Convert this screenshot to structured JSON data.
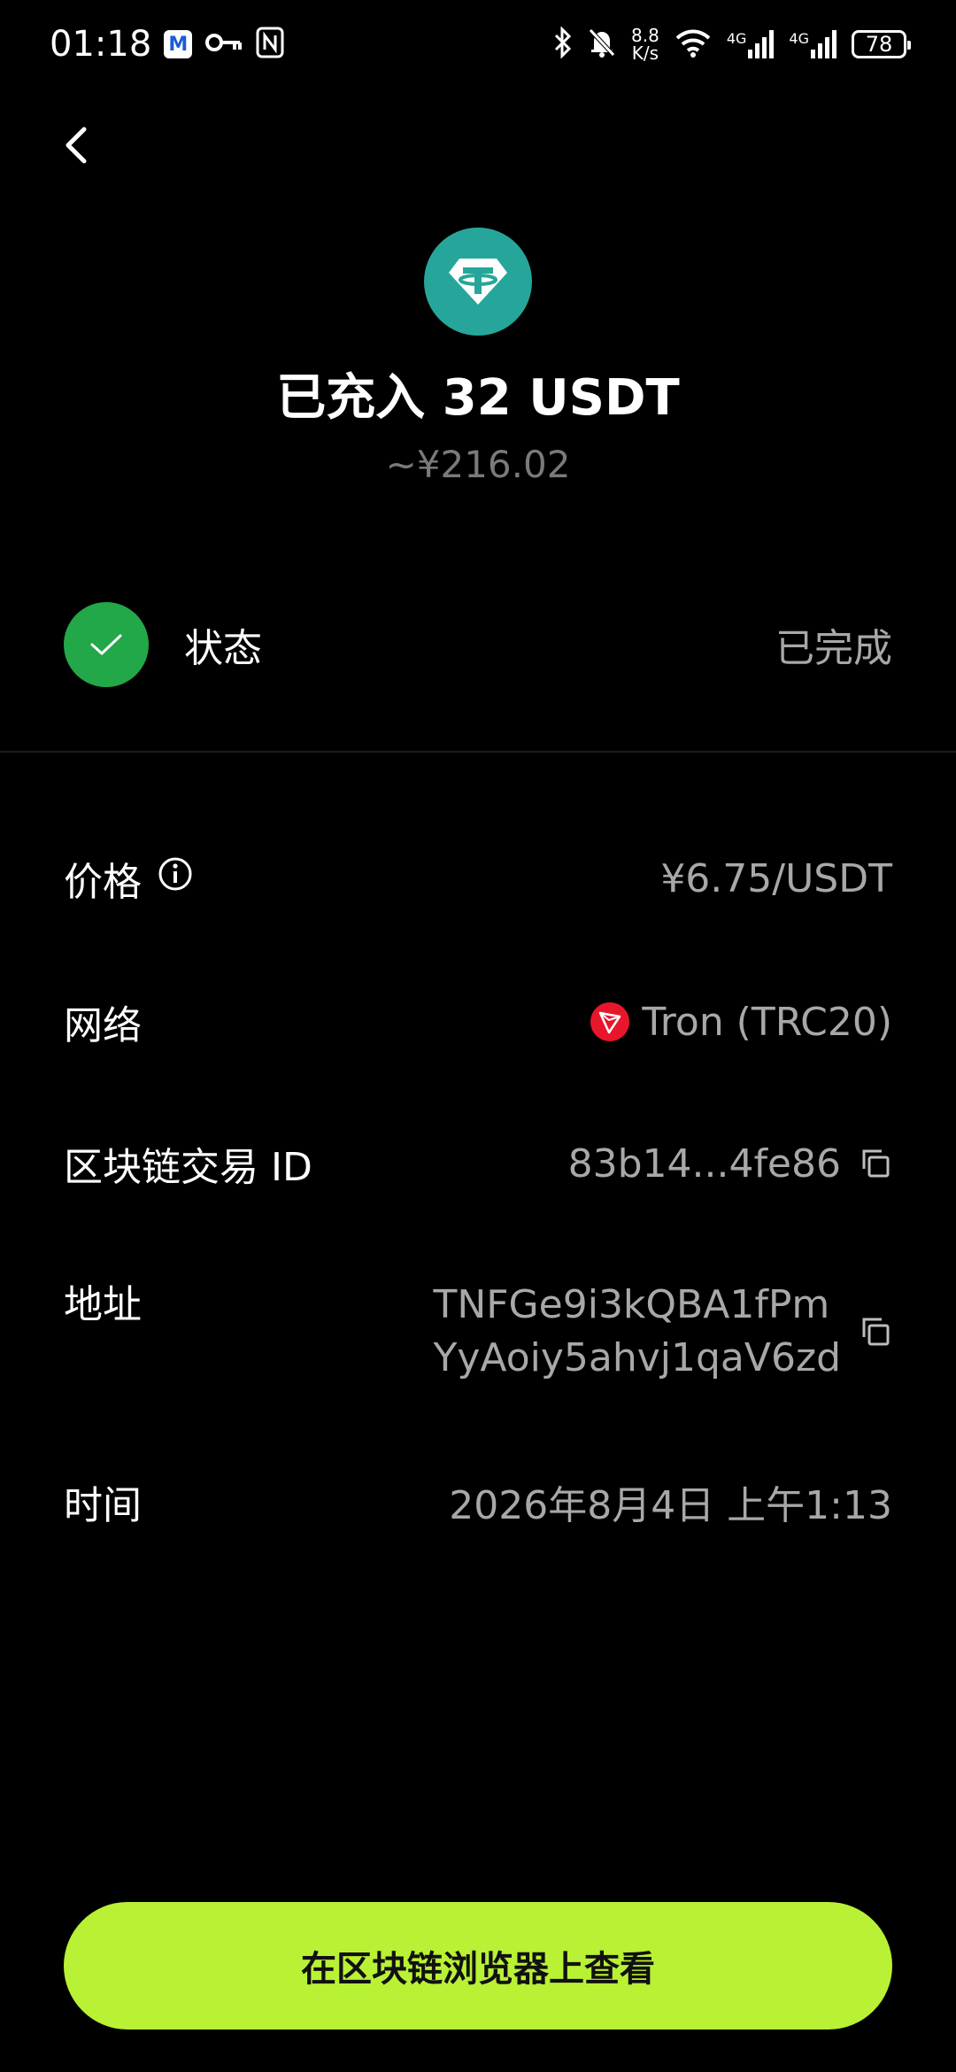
{
  "status_bar": {
    "time": "01:18",
    "mail_letter": "M",
    "net_speed_value": "8.8",
    "net_speed_unit": "K/s",
    "sim1_label": "4G",
    "sim2_label": "4G",
    "battery": "78"
  },
  "header": {
    "title": "已充入 32 USDT",
    "fiat_value": "~¥216.02"
  },
  "status": {
    "label": "状态",
    "value": "已完成"
  },
  "details": {
    "price": {
      "label": "价格",
      "value": "¥6.75/USDT"
    },
    "network": {
      "label": "网络",
      "value": "Tron (TRC20)"
    },
    "tx_id": {
      "label": "区块链交易 ID",
      "value": "83b14...4fe86"
    },
    "address": {
      "label": "地址",
      "line1": "TNFGe9i3kQBA1fPm",
      "line2": "YyAoiy5ahvj1qaV6zd"
    },
    "time": {
      "label": "时间",
      "value": "2026年8月4日 上午1:13"
    }
  },
  "explorer_button": {
    "label": "在区块链浏览器上查看"
  },
  "colors": {
    "accent": "#b9f135",
    "success": "#22a749",
    "usdt": "#26a69a",
    "tron": "#e8162a"
  }
}
